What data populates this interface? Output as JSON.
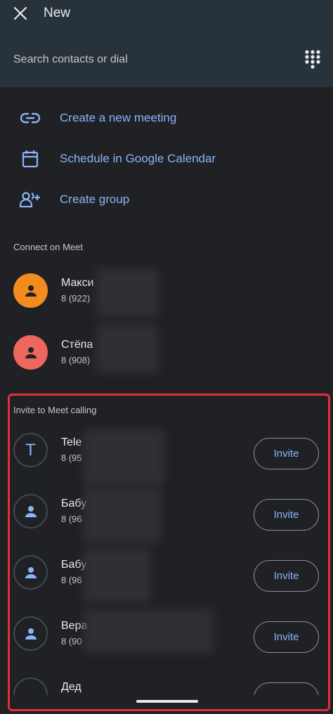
{
  "header": {
    "title": "New",
    "search_placeholder": "Search contacts or dial"
  },
  "actions": [
    {
      "label": "Create a new meeting",
      "icon": "link-icon"
    },
    {
      "label": "Schedule in Google Calendar",
      "icon": "calendar-icon"
    },
    {
      "label": "Create group",
      "icon": "group-add-icon"
    }
  ],
  "sections": {
    "connect": "Connect on Meet",
    "invite": "Invite to Meet calling"
  },
  "connect_contacts": [
    {
      "name": "Макси",
      "phone": "8 (922) ",
      "avatar_color": "#f38b1f"
    },
    {
      "name": "Стёпа",
      "phone": "8 (908) ",
      "avatar_color": "#ee675c"
    }
  ],
  "invite_contacts": [
    {
      "name": "Tele",
      "phone": "8 (95",
      "avatar_letter": "T",
      "button": "Invite"
    },
    {
      "name": "Бабу",
      "phone": "8 (96",
      "button": "Invite"
    },
    {
      "name": "Бабу",
      "phone": "8 (96",
      "button": "Invite"
    },
    {
      "name": "Вера",
      "phone": "8 (90",
      "button": "Invite"
    },
    {
      "name": "Дед",
      "phone": "",
      "button": ""
    }
  ],
  "colors": {
    "accent": "#8ab4f8",
    "background": "#202124",
    "header": "#28323a",
    "highlight": "#e0303a"
  }
}
